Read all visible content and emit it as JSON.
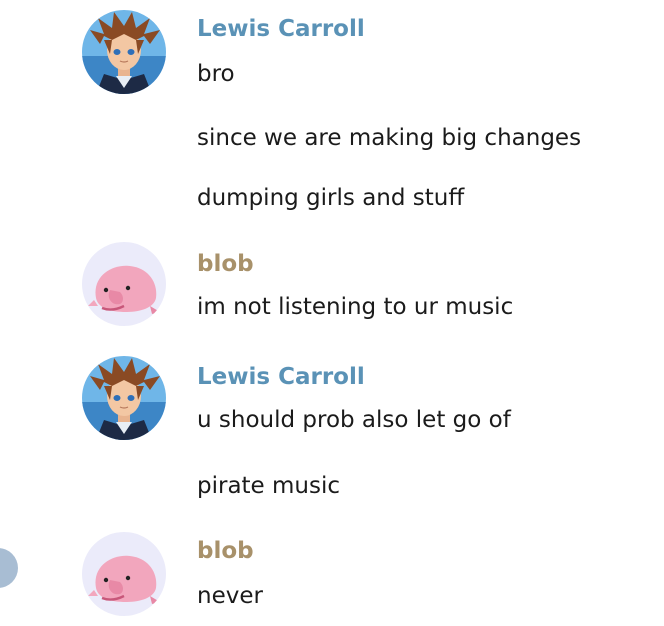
{
  "colors": {
    "lewis_name": "#5a92b6",
    "blob_name": "#a8916a",
    "text": "#1b1b1b",
    "blob_avatar_bg": "#ebebfa",
    "blob_body": "#f2a6bd"
  },
  "groups": [
    {
      "author": "Lewis Carroll",
      "avatar_icon": "sora-avatar-icon",
      "messages": [
        "bro",
        "since we are making big changes",
        "dumping girls and stuff"
      ]
    },
    {
      "author": "blob",
      "avatar_icon": "blobfish-avatar-icon",
      "messages": [
        "im not listening to ur music"
      ]
    },
    {
      "author": "Lewis Carroll",
      "avatar_icon": "sora-avatar-icon",
      "messages": [
        "u should prob also let go of",
        "pirate music"
      ]
    },
    {
      "author": "blob",
      "avatar_icon": "blobfish-avatar-icon",
      "messages": [
        "never"
      ]
    }
  ]
}
